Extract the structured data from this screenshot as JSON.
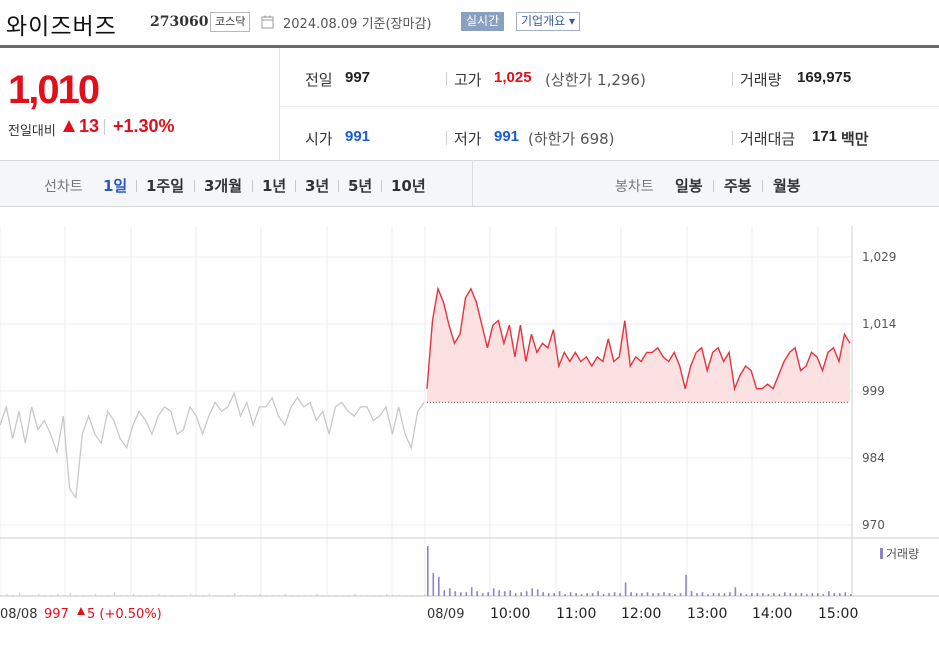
{
  "header": {
    "stock_name": "와이즈버즈",
    "stock_code": "273060",
    "market": "코스닥",
    "date_text": "2024.08.09 기준(장마감)",
    "realtime_label": "실시간",
    "company_button": "기업개요 ▾"
  },
  "price": {
    "current": "1,010",
    "change_label": "전일대비",
    "change_value": "13",
    "change_pct": "+1.30%"
  },
  "stats": {
    "prev_close_label": "전일",
    "prev_close": "997",
    "high_label": "고가",
    "high": "1,025",
    "upper_limit": "(상한가 1,296)",
    "volume_label": "거래량",
    "volume": "169,975",
    "open_label": "시가",
    "open": "991",
    "low_label": "저가",
    "low": "991",
    "lower_limit": "(하한가 698)",
    "amount_label": "거래대금",
    "amount": "171",
    "amount_unit": "백만"
  },
  "tabs": {
    "line_chart_label": "선차트",
    "periods": [
      "1일",
      "1주일",
      "3개월",
      "1년",
      "3년",
      "5년",
      "10년"
    ],
    "active_period": "1일",
    "candle_label": "봉차트",
    "candles": [
      "일봉",
      "주봉",
      "월봉"
    ]
  },
  "colors": {
    "up": "#e0101b",
    "today_line": "#e8323c",
    "today_fill": "#fce1e3",
    "prev_line": "#c8c8c8",
    "volume_bar": "#8f83c9",
    "active_tab": "#2a57c4"
  },
  "chart_data": {
    "type": "line",
    "y_ticks": [
      "1,029",
      "1,014",
      "999",
      "984",
      "970"
    ],
    "ylim": [
      970,
      1029
    ],
    "baseline": 997,
    "volume_legend": "거래량",
    "x_labels": [
      "08/08",
      "08/09",
      "10:00",
      "11:00",
      "12:00",
      "13:00",
      "14:00",
      "15:00"
    ],
    "prev_day_label": {
      "date": "08/08",
      "close": "997",
      "change": "5",
      "pct": "(+0.50%)"
    },
    "prev_day_series": {
      "name": "08/08",
      "values": [
        992,
        996,
        989,
        995,
        988,
        996,
        991,
        993,
        990,
        986,
        994,
        978,
        976,
        990,
        994,
        990,
        988,
        995,
        993,
        989,
        987,
        992,
        995,
        993,
        990,
        994,
        996,
        995,
        990,
        991,
        996,
        994,
        990,
        994,
        997,
        995,
        996,
        999,
        994,
        997,
        992,
        996,
        996,
        998,
        994,
        992,
        996,
        998,
        996,
        997,
        993,
        995,
        990,
        996,
        997,
        995,
        994,
        996,
        996,
        993,
        994,
        996,
        990,
        996,
        990,
        987,
        995,
        997
      ]
    },
    "today_series": {
      "name": "08/09",
      "values": [
        1000,
        1015,
        1022,
        1019,
        1014,
        1010,
        1012,
        1020,
        1022,
        1019,
        1014,
        1009,
        1014,
        1015,
        1010,
        1014,
        1007,
        1014,
        1006,
        1012,
        1008,
        1010,
        1009,
        1013,
        1005,
        1008,
        1006,
        1008,
        1006,
        1007,
        1005,
        1007,
        1006,
        1011,
        1006,
        1007,
        1015,
        1005,
        1007,
        1006,
        1008,
        1008,
        1009,
        1007,
        1006,
        1008,
        1005,
        1000,
        1005,
        1008,
        1009,
        1004,
        1008,
        1009,
        1006,
        1008,
        1000,
        1003,
        1005,
        1004,
        1000,
        1000,
        1001,
        1000,
        1003,
        1006,
        1008,
        1009,
        1004,
        1005,
        1008,
        1007,
        1004,
        1008,
        1009,
        1006,
        1012,
        1010
      ]
    },
    "volume_prev": [
      1,
      2,
      0,
      3,
      1,
      1,
      2,
      1,
      0,
      2,
      1,
      3,
      1,
      1,
      0,
      2,
      1,
      1,
      4,
      1,
      1,
      2,
      1,
      0,
      1,
      2,
      1,
      1,
      0,
      1,
      2,
      1,
      1,
      2,
      0,
      1,
      1,
      3,
      1,
      1,
      0,
      2,
      1,
      1,
      1,
      2,
      1,
      0,
      1,
      1,
      2,
      1,
      1,
      0,
      1,
      1,
      2,
      1,
      1,
      1,
      0,
      2,
      1,
      1,
      1,
      0,
      1,
      2
    ],
    "volume_today": [
      52,
      24,
      20,
      6,
      8,
      5,
      4,
      4,
      9,
      5,
      3,
      4,
      8,
      6,
      5,
      6,
      3,
      4,
      5,
      8,
      7,
      4,
      3,
      3,
      5,
      2,
      4,
      3,
      2,
      3,
      3,
      5,
      2,
      3,
      4,
      3,
      14,
      4,
      3,
      3,
      4,
      3,
      3,
      4,
      3,
      2,
      3,
      22,
      5,
      3,
      4,
      2,
      3,
      3,
      3,
      4,
      9,
      3,
      2,
      3,
      3,
      3,
      2,
      3,
      2,
      4,
      3,
      3,
      3,
      2,
      3,
      3,
      2,
      5,
      3,
      3,
      4,
      2
    ]
  }
}
